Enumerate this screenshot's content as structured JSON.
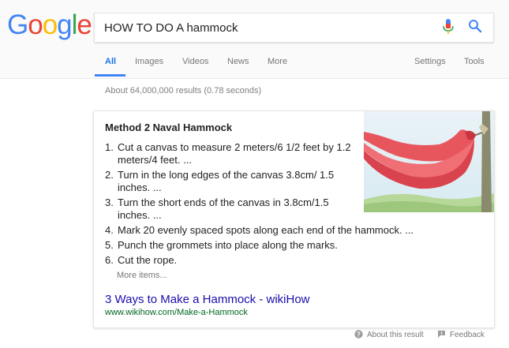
{
  "logo": {
    "letters": [
      "G",
      "o",
      "o",
      "g",
      "l",
      "e"
    ],
    "colors": [
      "#4285f4",
      "#ea4335",
      "#fbbc05",
      "#4285f4",
      "#34a853",
      "#ea4335"
    ]
  },
  "search": {
    "query": "HOW TO DO A hammock",
    "mic_icon": "microphone-icon",
    "search_icon": "magnifier-icon"
  },
  "tabs": {
    "all": "All",
    "images": "Images",
    "videos": "Videos",
    "news": "News",
    "more": "More",
    "settings": "Settings",
    "tools": "Tools"
  },
  "result_stats": "About 64,000,000 results (0.78 seconds)",
  "featured_snippet": {
    "title": "Method 2 Naval Hammock",
    "steps": [
      {
        "num": "1.",
        "text": "Cut a canvas to measure 2 meters/6 1/2 feet by 1.2 meters/4 feet. ..."
      },
      {
        "num": "2.",
        "text": "Turn in the long edges of the canvas 3.8cm/ 1.5 inches. ..."
      },
      {
        "num": "3.",
        "text": "Turn the short ends of the canvas in 3.8cm/1.5 inches. ..."
      },
      {
        "num": "4.",
        "text": "Mark 20 evenly spaced spots along each end of the hammock. ..."
      },
      {
        "num": "5.",
        "text": "Punch the grommets into place along the marks."
      },
      {
        "num": "6.",
        "text": "Cut the rope."
      }
    ],
    "more_items": "More items...",
    "link_title": "3 Ways to Make a Hammock - wikiHow",
    "url": "www.wikihow.com/Make-a-Hammock"
  },
  "footer": {
    "about": "About this result",
    "feedback": "Feedback"
  },
  "colors": {
    "accent": "#4285f4",
    "link": "#1a0dab",
    "url": "#006621",
    "hammock": "#e8565d"
  }
}
